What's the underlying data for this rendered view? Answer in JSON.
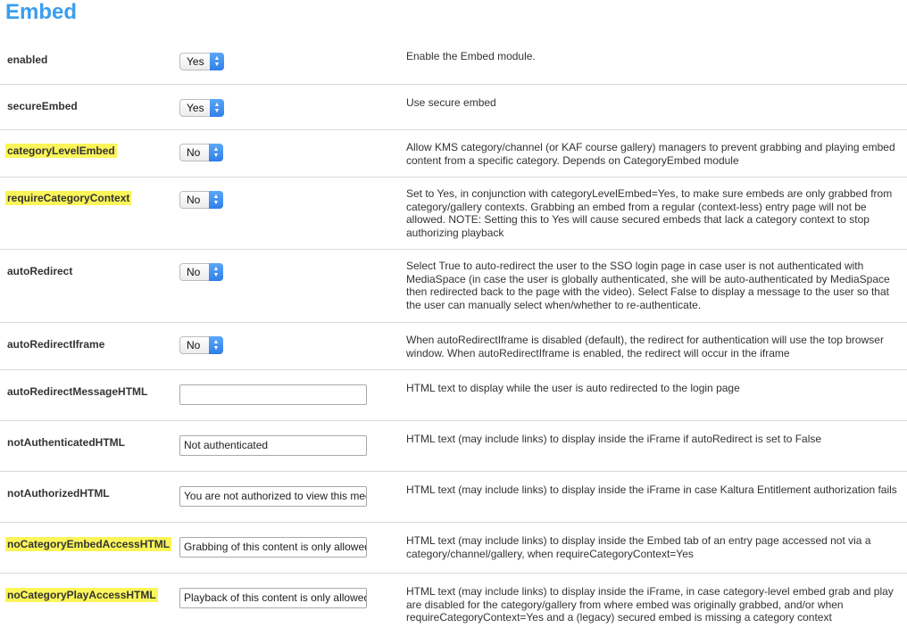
{
  "title": "Embed",
  "rows": [
    {
      "name": "enabled",
      "control": "select",
      "value": "Yes",
      "description": "Enable the Embed module."
    },
    {
      "name": "secureEmbed",
      "control": "select",
      "value": "Yes",
      "description": "Use secure embed"
    },
    {
      "name": "categoryLevelEmbed",
      "highlighted": true,
      "control": "select",
      "value": "No",
      "description": "Allow KMS category/channel (or KAF course gallery) managers to prevent grabbing and playing embed content from a specific category. Depends on CategoryEmbed module"
    },
    {
      "name": "requireCategoryContext",
      "highlighted": true,
      "control": "select",
      "value": "No",
      "description": "Set to Yes, in conjunction with categoryLevelEmbed=Yes, to make sure embeds are only grabbed from category/gallery contexts. Grabbing an embed from a regular (context-less) entry page will not be allowed. NOTE: Setting this to Yes will cause secured embeds that lack a category context to stop authorizing playback"
    },
    {
      "name": "autoRedirect",
      "control": "select",
      "value": "No",
      "description": "Select True to auto-redirect the user to the SSO login page in case user is not authenticated with MediaSpace (in case the user is globally authenticated, she will be auto-authenticated by MediaSpace then redirected back to the page with the video). Select False to display a message to the user so that the user can manually select when/whether to re-authenticate."
    },
    {
      "name": "autoRedirectIframe",
      "control": "select",
      "value": "No",
      "description": "When autoRedirectIframe is disabled (default), the redirect for authentication will use the top browser window. When autoRedirectIframe is enabled, the redirect will occur in the iframe"
    },
    {
      "name": "autoRedirectMessageHTML",
      "control": "text",
      "value": "",
      "description": "HTML text to display while the user is auto redirected to the login page"
    },
    {
      "name": "notAuthenticatedHTML",
      "control": "text",
      "value": "Not authenticated",
      "description": "HTML text (may include links) to display inside the iFrame if autoRedirect is set to False"
    },
    {
      "name": "notAuthorizedHTML",
      "control": "text",
      "value": "You are not authorized to view this media",
      "description": "HTML text (may include links) to display inside the iFrame in case Kaltura Entitlement authorization fails"
    },
    {
      "name": "noCategoryEmbedAccessHTML",
      "highlighted": true,
      "control": "text",
      "value": "Grabbing of this content is only allowed",
      "description": "HTML text (may include links) to display inside the Embed tab of an entry page accessed not via a category/channel/gallery, when requireCategoryContext=Yes"
    },
    {
      "name": "noCategoryPlayAccessHTML",
      "highlighted": true,
      "control": "text",
      "value": "Playback of this content is only allowed",
      "description": "HTML text (may include links) to display inside the iFrame, in case category-level embed grab and play are disabled for the category/gallery from where embed was originally grabbed, and/or when requireCategoryContext=Yes and a (legacy) secured embed is missing a category context"
    }
  ]
}
